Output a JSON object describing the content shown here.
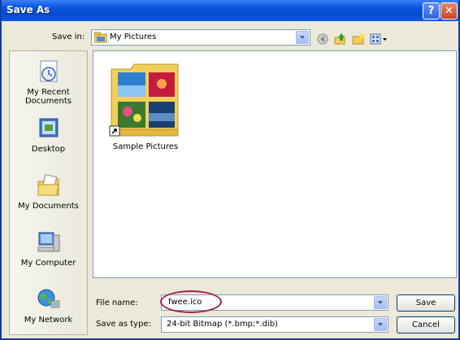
{
  "window": {
    "title": "Save As"
  },
  "titlebar": {
    "help_glyph": "?",
    "close_glyph": "✕"
  },
  "save_in": {
    "label": "Save in:",
    "value": "My Pictures"
  },
  "toolbar": {
    "icons": [
      "back-icon",
      "up-folder-icon",
      "new-folder-icon",
      "views-menu-icon"
    ]
  },
  "places": {
    "items": [
      {
        "label_line1": "My Recent",
        "label_line2": "Documents",
        "icon": "recent-documents-icon"
      },
      {
        "label_line1": "Desktop",
        "label_line2": "",
        "icon": "desktop-icon"
      },
      {
        "label_line1": "My Documents",
        "label_line2": "",
        "icon": "my-documents-icon"
      },
      {
        "label_line1": "My Computer",
        "label_line2": "",
        "icon": "my-computer-icon"
      },
      {
        "label_line1": "My Network",
        "label_line2": "",
        "icon": "my-network-icon"
      }
    ]
  },
  "files": [
    {
      "name": "Sample Pictures",
      "type": "folder-shortcut"
    }
  ],
  "file_name": {
    "label": "File name:",
    "value": "fwee.ico"
  },
  "save_as_type": {
    "label": "Save as type:",
    "value": "24-bit Bitmap (*.bmp;*.dib)"
  },
  "buttons": {
    "save": "Save",
    "cancel": "Cancel"
  },
  "colors": {
    "title_bar": "#0b56e0",
    "highlight_ellipse": "#a21f4d"
  }
}
